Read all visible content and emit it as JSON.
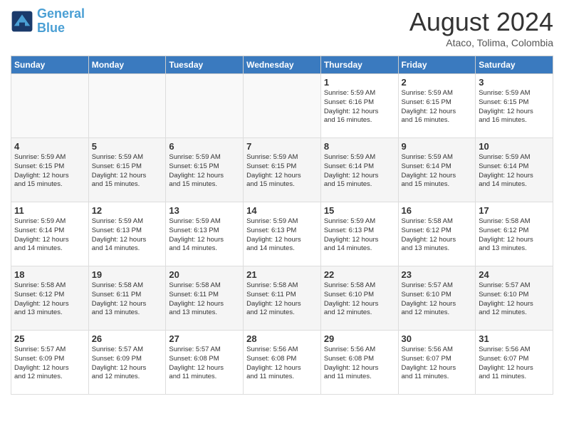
{
  "header": {
    "logo_line1": "General",
    "logo_line2": "Blue",
    "month": "August 2024",
    "location": "Ataco, Tolima, Colombia"
  },
  "weekdays": [
    "Sunday",
    "Monday",
    "Tuesday",
    "Wednesday",
    "Thursday",
    "Friday",
    "Saturday"
  ],
  "weeks": [
    [
      {
        "day": "",
        "content": ""
      },
      {
        "day": "",
        "content": ""
      },
      {
        "day": "",
        "content": ""
      },
      {
        "day": "",
        "content": ""
      },
      {
        "day": "1",
        "content": "Sunrise: 5:59 AM\nSunset: 6:16 PM\nDaylight: 12 hours\nand 16 minutes."
      },
      {
        "day": "2",
        "content": "Sunrise: 5:59 AM\nSunset: 6:15 PM\nDaylight: 12 hours\nand 16 minutes."
      },
      {
        "day": "3",
        "content": "Sunrise: 5:59 AM\nSunset: 6:15 PM\nDaylight: 12 hours\nand 16 minutes."
      }
    ],
    [
      {
        "day": "4",
        "content": "Sunrise: 5:59 AM\nSunset: 6:15 PM\nDaylight: 12 hours\nand 15 minutes."
      },
      {
        "day": "5",
        "content": "Sunrise: 5:59 AM\nSunset: 6:15 PM\nDaylight: 12 hours\nand 15 minutes."
      },
      {
        "day": "6",
        "content": "Sunrise: 5:59 AM\nSunset: 6:15 PM\nDaylight: 12 hours\nand 15 minutes."
      },
      {
        "day": "7",
        "content": "Sunrise: 5:59 AM\nSunset: 6:15 PM\nDaylight: 12 hours\nand 15 minutes."
      },
      {
        "day": "8",
        "content": "Sunrise: 5:59 AM\nSunset: 6:14 PM\nDaylight: 12 hours\nand 15 minutes."
      },
      {
        "day": "9",
        "content": "Sunrise: 5:59 AM\nSunset: 6:14 PM\nDaylight: 12 hours\nand 15 minutes."
      },
      {
        "day": "10",
        "content": "Sunrise: 5:59 AM\nSunset: 6:14 PM\nDaylight: 12 hours\nand 14 minutes."
      }
    ],
    [
      {
        "day": "11",
        "content": "Sunrise: 5:59 AM\nSunset: 6:14 PM\nDaylight: 12 hours\nand 14 minutes."
      },
      {
        "day": "12",
        "content": "Sunrise: 5:59 AM\nSunset: 6:13 PM\nDaylight: 12 hours\nand 14 minutes."
      },
      {
        "day": "13",
        "content": "Sunrise: 5:59 AM\nSunset: 6:13 PM\nDaylight: 12 hours\nand 14 minutes."
      },
      {
        "day": "14",
        "content": "Sunrise: 5:59 AM\nSunset: 6:13 PM\nDaylight: 12 hours\nand 14 minutes."
      },
      {
        "day": "15",
        "content": "Sunrise: 5:59 AM\nSunset: 6:13 PM\nDaylight: 12 hours\nand 14 minutes."
      },
      {
        "day": "16",
        "content": "Sunrise: 5:58 AM\nSunset: 6:12 PM\nDaylight: 12 hours\nand 13 minutes."
      },
      {
        "day": "17",
        "content": "Sunrise: 5:58 AM\nSunset: 6:12 PM\nDaylight: 12 hours\nand 13 minutes."
      }
    ],
    [
      {
        "day": "18",
        "content": "Sunrise: 5:58 AM\nSunset: 6:12 PM\nDaylight: 12 hours\nand 13 minutes."
      },
      {
        "day": "19",
        "content": "Sunrise: 5:58 AM\nSunset: 6:11 PM\nDaylight: 12 hours\nand 13 minutes."
      },
      {
        "day": "20",
        "content": "Sunrise: 5:58 AM\nSunset: 6:11 PM\nDaylight: 12 hours\nand 13 minutes."
      },
      {
        "day": "21",
        "content": "Sunrise: 5:58 AM\nSunset: 6:11 PM\nDaylight: 12 hours\nand 12 minutes."
      },
      {
        "day": "22",
        "content": "Sunrise: 5:58 AM\nSunset: 6:10 PM\nDaylight: 12 hours\nand 12 minutes."
      },
      {
        "day": "23",
        "content": "Sunrise: 5:57 AM\nSunset: 6:10 PM\nDaylight: 12 hours\nand 12 minutes."
      },
      {
        "day": "24",
        "content": "Sunrise: 5:57 AM\nSunset: 6:10 PM\nDaylight: 12 hours\nand 12 minutes."
      }
    ],
    [
      {
        "day": "25",
        "content": "Sunrise: 5:57 AM\nSunset: 6:09 PM\nDaylight: 12 hours\nand 12 minutes."
      },
      {
        "day": "26",
        "content": "Sunrise: 5:57 AM\nSunset: 6:09 PM\nDaylight: 12 hours\nand 12 minutes."
      },
      {
        "day": "27",
        "content": "Sunrise: 5:57 AM\nSunset: 6:08 PM\nDaylight: 12 hours\nand 11 minutes."
      },
      {
        "day": "28",
        "content": "Sunrise: 5:56 AM\nSunset: 6:08 PM\nDaylight: 12 hours\nand 11 minutes."
      },
      {
        "day": "29",
        "content": "Sunrise: 5:56 AM\nSunset: 6:08 PM\nDaylight: 12 hours\nand 11 minutes."
      },
      {
        "day": "30",
        "content": "Sunrise: 5:56 AM\nSunset: 6:07 PM\nDaylight: 12 hours\nand 11 minutes."
      },
      {
        "day": "31",
        "content": "Sunrise: 5:56 AM\nSunset: 6:07 PM\nDaylight: 12 hours\nand 11 minutes."
      }
    ]
  ]
}
